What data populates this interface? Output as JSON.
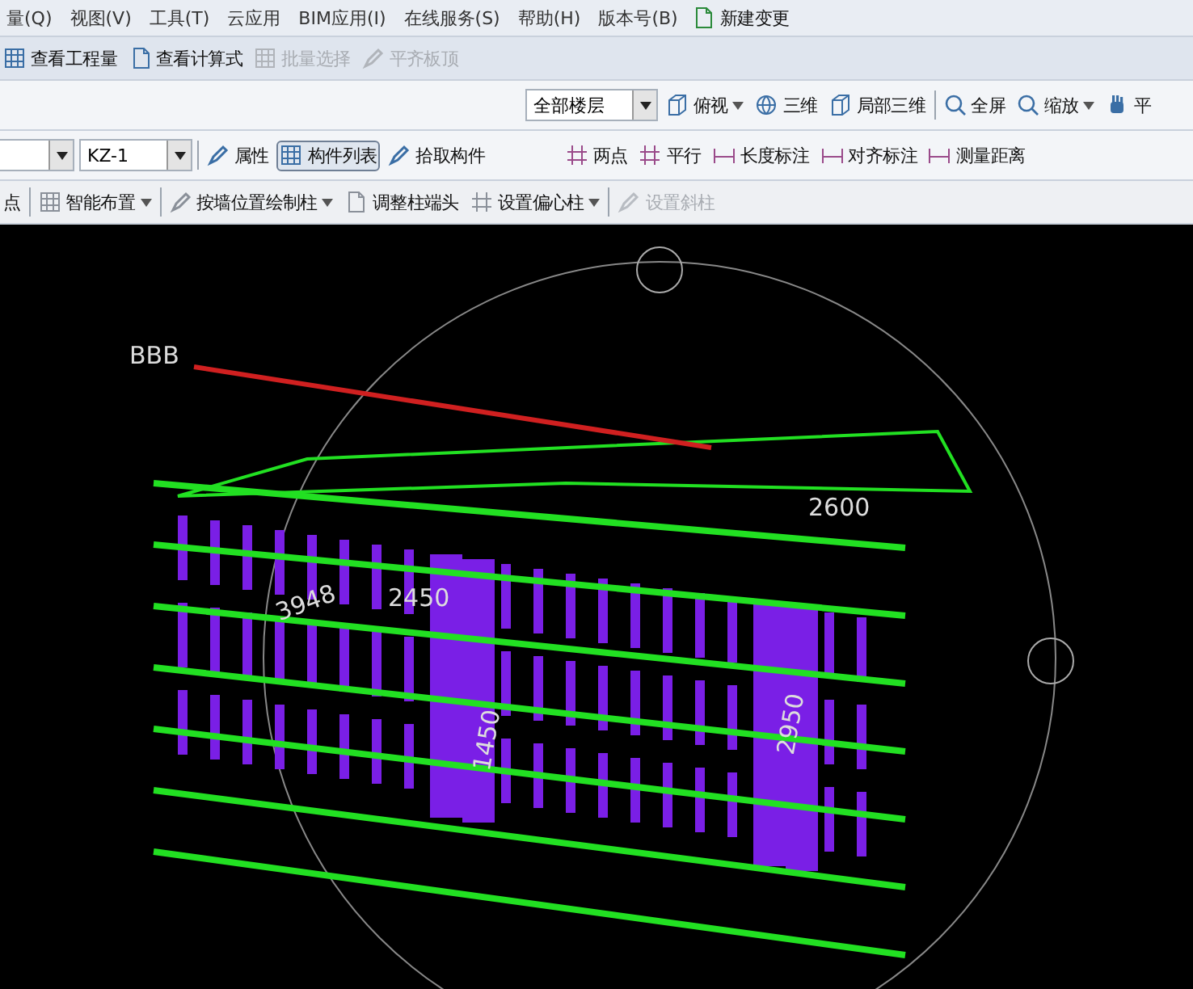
{
  "menu_bar": {
    "items": [
      {
        "label": "量(Q)"
      },
      {
        "label": "视图(V)"
      },
      {
        "label": "工具(T)"
      },
      {
        "label": "云应用"
      },
      {
        "label": "BIM应用(I)"
      },
      {
        "label": "在线服务(S)"
      },
      {
        "label": "帮助(H)"
      },
      {
        "label": "版本号(B)"
      }
    ],
    "action": {
      "label": "新建变更"
    }
  },
  "toolbar_1": [
    {
      "label": "查看工程量",
      "disabled": false
    },
    {
      "label": "查看计算式",
      "disabled": false
    },
    {
      "label": "批量选择",
      "disabled": true
    },
    {
      "label": "平齐板顶",
      "disabled": true
    }
  ],
  "view_toolbar": {
    "floor_select": {
      "value": "全部楼层"
    },
    "items": [
      {
        "label": "俯视",
        "dropdown": true
      },
      {
        "label": "三维",
        "dropdown": false
      },
      {
        "label": "局部三维",
        "dropdown": false
      },
      {
        "label": "全屏",
        "dropdown": false
      },
      {
        "label": "缩放",
        "dropdown": true
      },
      {
        "label": "平",
        "dropdown": false
      }
    ]
  },
  "component_toolbar": {
    "component_select": {
      "value": "KZ-1"
    },
    "items": [
      {
        "label": "属性",
        "selected": false
      },
      {
        "label": "构件列表",
        "selected": true
      },
      {
        "label": "拾取构件",
        "selected": false
      }
    ]
  },
  "measure_toolbar": [
    {
      "label": "两点"
    },
    {
      "label": "平行"
    },
    {
      "label": "长度标注"
    },
    {
      "label": "对齐标注"
    },
    {
      "label": "测量距离"
    }
  ],
  "draw_toolbar": [
    {
      "label": "点",
      "dropdown": false,
      "disabled": false
    },
    {
      "label": "智能布置",
      "dropdown": true,
      "disabled": false
    },
    {
      "label": "按墙位置绘制柱",
      "dropdown": true,
      "disabled": false
    },
    {
      "label": "调整柱端头",
      "dropdown": false,
      "disabled": false
    },
    {
      "label": "设置偏心柱",
      "dropdown": true,
      "disabled": false
    },
    {
      "label": "设置斜柱",
      "dropdown": false,
      "disabled": true
    }
  ],
  "viewport": {
    "labels": [
      "BBB",
      "2600",
      "2450",
      "3948",
      "2950",
      "1450"
    ]
  }
}
